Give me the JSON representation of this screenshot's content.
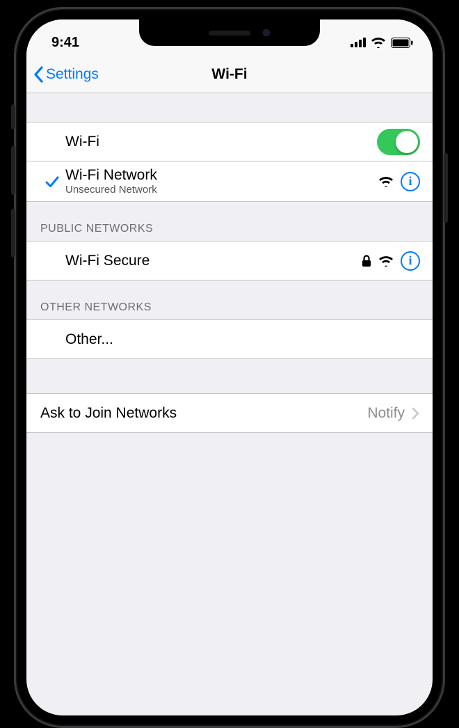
{
  "status": {
    "time": "9:41"
  },
  "nav": {
    "back_label": "Settings",
    "title": "Wi-Fi"
  },
  "wifi": {
    "toggle_label": "Wi-Fi",
    "toggle_on": true,
    "current": {
      "name": "Wi-Fi Network",
      "detail": "Unsecured Network"
    }
  },
  "sections": {
    "public_header": "PUBLIC NETWORKS",
    "public_items": [
      {
        "name": "Wi-Fi Secure",
        "locked": true
      }
    ],
    "other_header": "OTHER NETWORKS",
    "other_label": "Other..."
  },
  "ask": {
    "label": "Ask to Join Networks",
    "value": "Notify"
  }
}
